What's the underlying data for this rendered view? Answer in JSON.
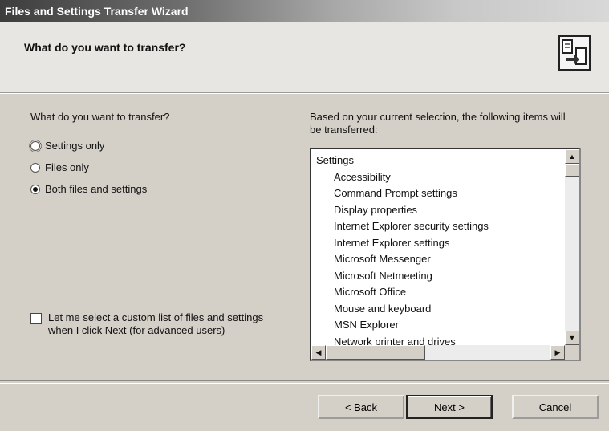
{
  "window": {
    "title": "Files and Settings Transfer Wizard"
  },
  "header": {
    "title": "What do you want to transfer?"
  },
  "left": {
    "question": "What do you want to transfer?",
    "options": [
      {
        "label": "Settings only",
        "checked": false
      },
      {
        "label": "Files only",
        "checked": false
      },
      {
        "label": "Both files and settings",
        "checked": true
      }
    ],
    "custom_checkbox": {
      "line1": "Let me select a custom list of files and settings",
      "line2": "when I click Next (for advanced users)",
      "checked": false
    }
  },
  "right": {
    "description": "Based on your current selection, the following items will be transferred:",
    "list": {
      "group": "Settings",
      "items": [
        "Accessibility",
        "Command Prompt settings",
        "Display properties",
        "Internet Explorer security settings",
        "Internet Explorer settings",
        "Microsoft Messenger",
        "Microsoft Netmeeting",
        "Microsoft Office",
        "Mouse and keyboard",
        "MSN Explorer",
        "Network printer and drives"
      ]
    }
  },
  "buttons": {
    "back": "< Back",
    "next": "Next >",
    "cancel": "Cancel"
  },
  "icons": {
    "wizard": "transfer-wizard-icon",
    "scroll_up": "arrow-up-icon",
    "scroll_down": "arrow-down-icon",
    "scroll_left": "arrow-left-icon",
    "scroll_right": "arrow-right-icon"
  }
}
